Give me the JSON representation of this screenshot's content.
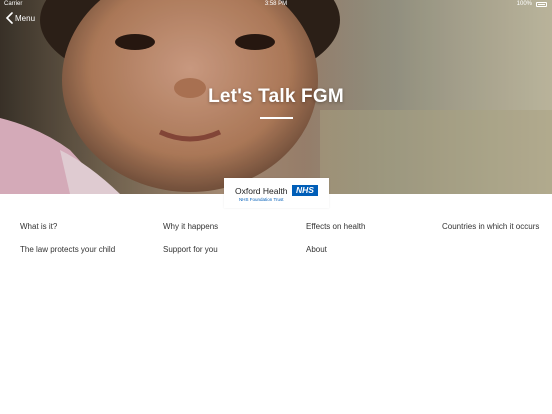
{
  "status": {
    "carrier": "Carrier",
    "time": "3:58 PM",
    "battery": "100%"
  },
  "nav_back": {
    "label": "Menu"
  },
  "hero": {
    "title": "Let's Talk FGM"
  },
  "logo": {
    "org": "Oxford Health",
    "badge": "NHS",
    "trust": "NHS Foundation Trust"
  },
  "menu": {
    "row1": [
      "What is it?",
      "Why it happens",
      "Effects on health",
      "Countries in which it occurs"
    ],
    "row2": [
      "The law protects your child",
      "Support for you",
      "About"
    ]
  },
  "colors": {
    "nhs_blue": "#005eb8",
    "text": "#333333",
    "background": "#ffffff"
  }
}
